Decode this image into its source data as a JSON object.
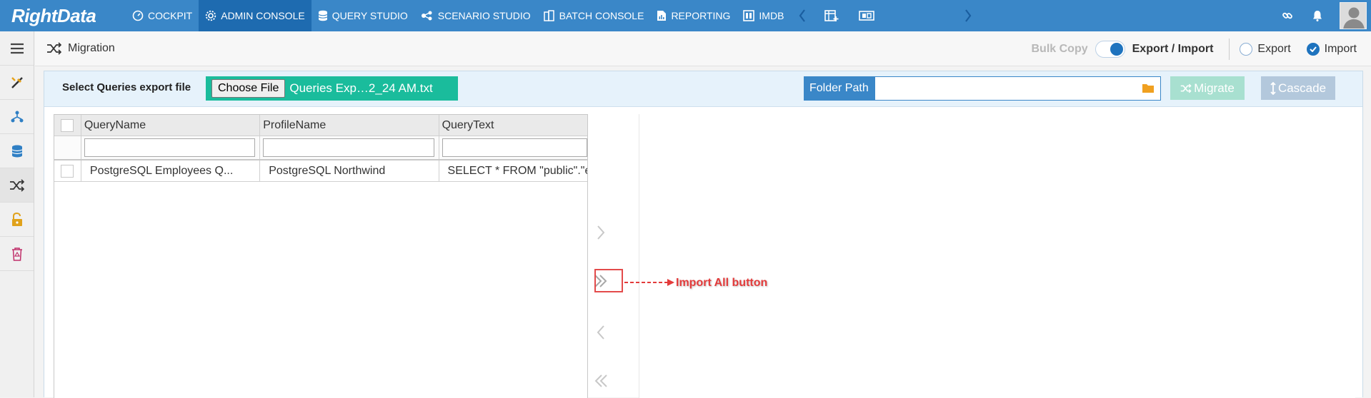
{
  "app": {
    "logo": "RightData"
  },
  "nav": {
    "items": [
      {
        "label": "COCKPIT",
        "icon": "gauge-icon",
        "active": false
      },
      {
        "label": "ADMIN CONSOLE",
        "icon": "gear-icon",
        "active": true
      },
      {
        "label": "QUERY STUDIO",
        "icon": "database-icon",
        "active": false
      },
      {
        "label": "SCENARIO STUDIO",
        "icon": "scenario-icon",
        "active": false
      },
      {
        "label": "BATCH CONSOLE",
        "icon": "batch-icon",
        "active": false
      },
      {
        "label": "REPORTING",
        "icon": "report-icon",
        "active": false
      },
      {
        "label": "IMDB",
        "icon": "imdb-icon",
        "active": false
      }
    ]
  },
  "breadcrumb": {
    "title": "Migration"
  },
  "modes": {
    "bulk_copy": "Bulk Copy",
    "export_import": "Export / Import",
    "export": "Export",
    "import": "Import",
    "selected": "Import"
  },
  "filebar": {
    "label": "Select Queries export file",
    "choose_button": "Choose File",
    "file_name": "Queries Exp…2_24 AM.txt",
    "folder_label": "Folder Path",
    "folder_value": "",
    "migrate_label": "Migrate",
    "cascade_label": "Cascade"
  },
  "grid": {
    "columns": [
      "QueryName",
      "ProfileName",
      "QueryText"
    ],
    "rows": [
      {
        "query_name": "PostgreSQL Employees Q...",
        "profile_name": "PostgreSQL Northwind",
        "query_text": "SELECT * FROM \"public\".\"e"
      }
    ]
  },
  "annotation": {
    "text": "Import All button"
  },
  "colors": {
    "nav": "#3a87c8",
    "nav_active": "#1e6bb0",
    "file_input": "#1abc9c",
    "migrate_disabled": "#a8e0d0",
    "cascade_disabled": "#b3c8dc",
    "annotation": "#e33b3b"
  }
}
